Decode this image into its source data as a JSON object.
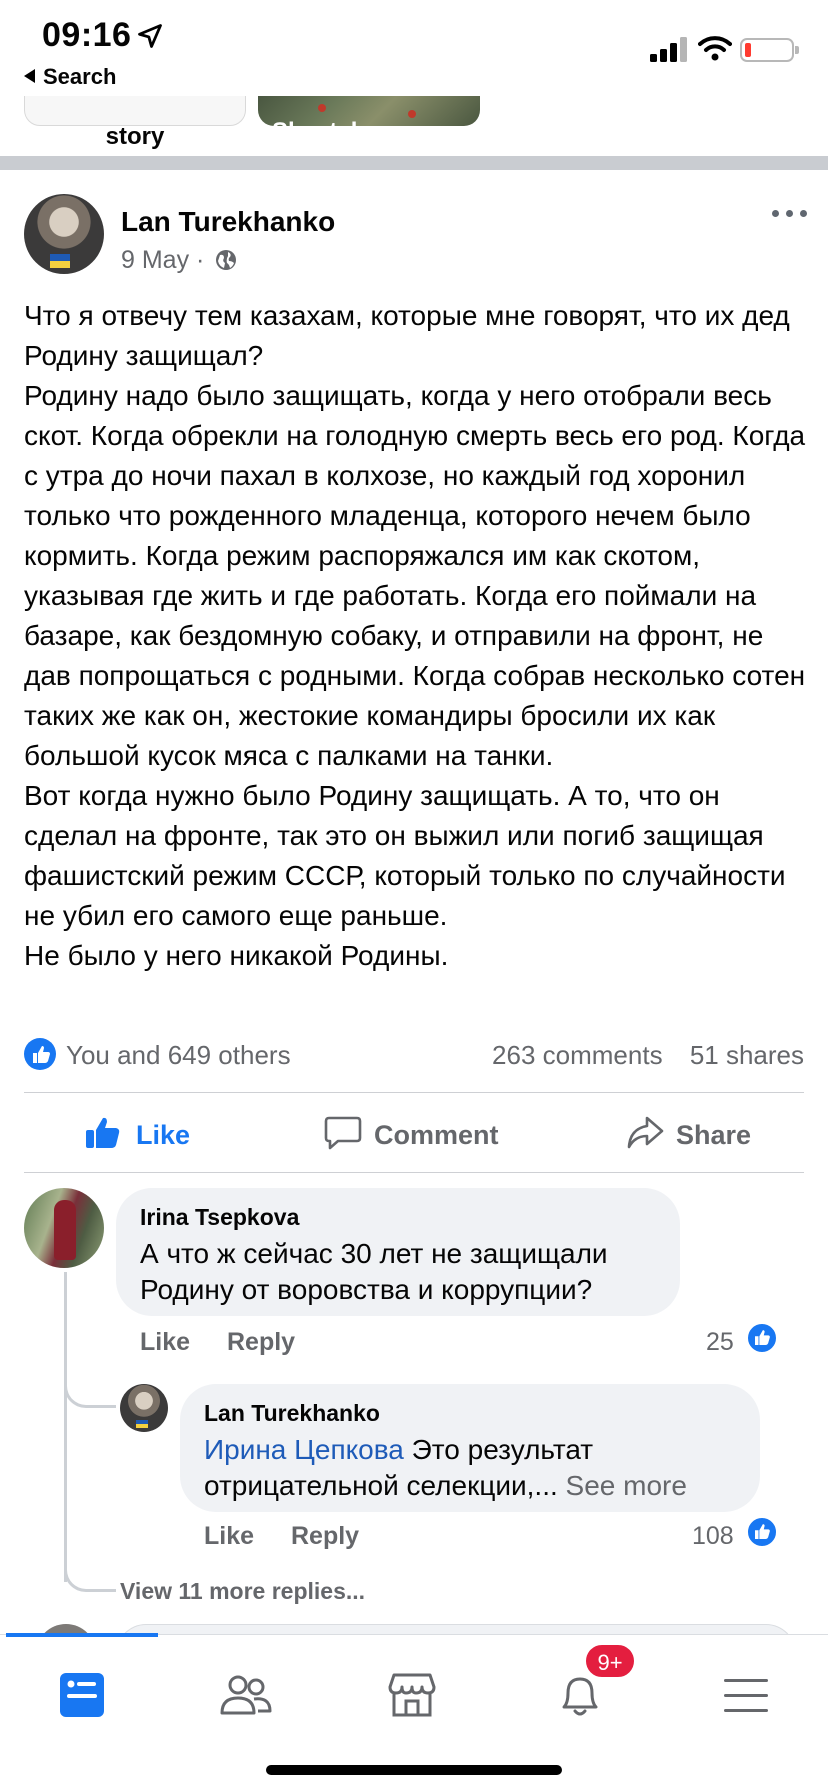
{
  "status_bar": {
    "time": "09:16",
    "back_label": "Search"
  },
  "stories": [
    {
      "label": "story"
    },
    {
      "label": "Shestakova"
    }
  ],
  "post": {
    "author": "Lan Turekhanko",
    "date": "9 May",
    "separator": "·",
    "visibility_icon": "globe-icon",
    "paragraphs": [
      "Что я отвечу тем казахам, которые мне говорят, что их дед Родину защищал?",
      "Родину надо было защищать, когда у него отобрали весь скот. Когда обрекли на голодную смерть весь его род. Когда с утра до ночи пахал в колхозе, но каждый год хоронил только что рожденного младенца, которого нечем было кормить. Когда режим распоряжался им как скотом, указывая где жить и где работать. Когда его поймали на базаре, как бездомную собаку, и отправили на фронт, не дав попрощаться с родными. Когда собрав несколько сотен таких же как он, жестокие командиры бросили их как большой кусок мяса с палками на танки.",
      "Вот когда нужно было Родину защищать. А то, что он сделал на фронте, так это он выжил или погиб защищая фашистский режим СССР, который только по случайности не убил его самого еще раньше.",
      "Не было у него никакой Родины."
    ],
    "reactions_text": "You and 649 others",
    "comments_count": "263 comments",
    "shares_count": "51 shares",
    "actions": {
      "like": "Like",
      "comment": "Comment",
      "share": "Share"
    }
  },
  "comments": [
    {
      "author": "Irina  Tsepkova",
      "text": "А что ж сейчас 30 лет не защищали Родину от воровства и коррупции?",
      "like_label": "Like",
      "reply_label": "Reply",
      "like_count": "25"
    },
    {
      "author": "Lan Turekhanko",
      "mention": "Ирина Цепкова",
      "text_line1_rest": " Это результат",
      "text_line2": "отрицательной селекции,...",
      "see_more": "See more",
      "like_label": "Like",
      "reply_label": "Reply",
      "like_count": "108"
    }
  ],
  "view_more_replies": "View 11 more replies...",
  "tabbar": {
    "notifications_badge": "9+",
    "accent_color": "#1877f2",
    "badge_color": "#e41e3f",
    "tabs": [
      "news-feed-icon",
      "friends-icon",
      "marketplace-icon",
      "notifications-icon",
      "menu-icon"
    ]
  }
}
